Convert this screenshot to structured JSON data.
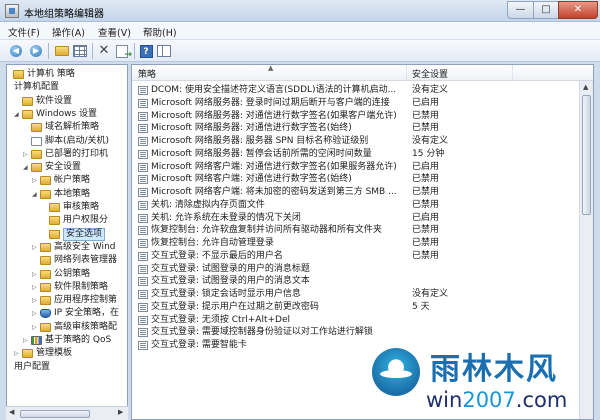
{
  "window": {
    "title": "本地组策略编辑器",
    "min": "—",
    "max": "□",
    "close": "✕"
  },
  "menu": [
    "文件(F)",
    "操作(A)",
    "查看(V)",
    "帮助(H)"
  ],
  "toolbar": {
    "icons": [
      "back-arrow-icon",
      "forward-arrow-icon",
      "up-folder-icon",
      "show-tree-icon",
      "delete-icon",
      "export-list-icon",
      "help-icon",
      "pane-view-icon"
    ],
    "back": "◀",
    "forward": "▶",
    "delete": "✕",
    "help": "?"
  },
  "tree": [
    {
      "label": "计算机 策略",
      "indent": 0,
      "icon": "computer",
      "expander": ""
    },
    {
      "label": "计算机配置",
      "indent": 0,
      "icon": "none",
      "expander": ""
    },
    {
      "label": "软件设置",
      "indent": 1,
      "icon": "folder",
      "expander": ""
    },
    {
      "label": "Windows 设置",
      "indent": 1,
      "icon": "folder",
      "expander": "◢"
    },
    {
      "label": "域名解析策略",
      "indent": 2,
      "icon": "folder",
      "expander": ""
    },
    {
      "label": "脚本(启动/关机)",
      "indent": 2,
      "icon": "doc",
      "expander": ""
    },
    {
      "label": "已部署的打印机",
      "indent": 2,
      "icon": "folder",
      "expander": "▷"
    },
    {
      "label": "安全设置",
      "indent": 2,
      "icon": "sec",
      "expander": "◢"
    },
    {
      "label": "帐户策略",
      "indent": 3,
      "icon": "folder",
      "expander": "▷"
    },
    {
      "label": "本地策略",
      "indent": 3,
      "icon": "folder",
      "expander": "◢"
    },
    {
      "label": "审核策略",
      "indent": 4,
      "icon": "folder",
      "expander": ""
    },
    {
      "label": "用户权限分",
      "indent": 4,
      "icon": "folder",
      "expander": ""
    },
    {
      "label": "安全选项",
      "indent": 4,
      "icon": "folder",
      "expander": "",
      "selected": true
    },
    {
      "label": "高级安全 Wind",
      "indent": 3,
      "icon": "folder",
      "expander": "▷"
    },
    {
      "label": "网络列表管理器",
      "indent": 3,
      "icon": "folder",
      "expander": ""
    },
    {
      "label": "公钥策略",
      "indent": 3,
      "icon": "folder",
      "expander": "▷"
    },
    {
      "label": "软件限制策略",
      "indent": 3,
      "icon": "folder",
      "expander": "▷"
    },
    {
      "label": "应用程序控制第",
      "indent": 3,
      "icon": "folder",
      "expander": "▷"
    },
    {
      "label": "IP 安全策略，在",
      "indent": 3,
      "icon": "shield",
      "expander": "▷"
    },
    {
      "label": "高级审核策略配",
      "indent": 3,
      "icon": "folder",
      "expander": "▷"
    },
    {
      "label": "基于策略的 QoS",
      "indent": 2,
      "icon": "chart",
      "expander": "▷"
    },
    {
      "label": "管理模板",
      "indent": 1,
      "icon": "folder",
      "expander": "▷"
    },
    {
      "label": "用户配置",
      "indent": 0,
      "icon": "none",
      "expander": ""
    }
  ],
  "list": {
    "columns": {
      "policy": "策略",
      "setting": "安全设置"
    },
    "rows": [
      {
        "policy": "DCOM: 使用安全描述符定义语言(SDDL)语法的计算机启动...",
        "setting": "没有定义"
      },
      {
        "policy": "Microsoft 网络服务器: 登录时间过期后断开与客户端的连接",
        "setting": "已启用"
      },
      {
        "policy": "Microsoft 网络服务器: 对通信进行数字签名(如果客户端允许)",
        "setting": "已禁用"
      },
      {
        "policy": "Microsoft 网络服务器: 对通信进行数字签名(始终)",
        "setting": "已禁用"
      },
      {
        "policy": "Microsoft 网络服务器: 服务器 SPN 目标名称验证级别",
        "setting": "没有定义"
      },
      {
        "policy": "Microsoft 网络服务器: 暂停会话前所需的空闲时间数量",
        "setting": "15 分钟"
      },
      {
        "policy": "Microsoft 网络客户端: 对通信进行数字签名(如果服务器允许)",
        "setting": "已启用"
      },
      {
        "policy": "Microsoft 网络客户端: 对通信进行数字签名(始终)",
        "setting": "已禁用"
      },
      {
        "policy": "Microsoft 网络客户端: 将未加密的密码发送到第三方 SMB ...",
        "setting": "已禁用"
      },
      {
        "policy": "关机: 清除虚拟内存页面文件",
        "setting": "已禁用"
      },
      {
        "policy": "关机: 允许系统在未登录的情况下关闭",
        "setting": "已启用"
      },
      {
        "policy": "恢复控制台: 允许软盘复制并访问所有驱动器和所有文件夹",
        "setting": "已禁用"
      },
      {
        "policy": "恢复控制台: 允许自动管理登录",
        "setting": "已禁用"
      },
      {
        "policy": "交互式登录: 不显示最后的用户名",
        "setting": "已禁用"
      },
      {
        "policy": "交互式登录: 试图登录的用户的消息标题",
        "setting": ""
      },
      {
        "policy": "交互式登录: 试图登录的用户的消息文本",
        "setting": ""
      },
      {
        "policy": "交互式登录: 锁定会话时显示用户信息",
        "setting": "没有定义"
      },
      {
        "policy": "交互式登录: 提示用户在过期之前更改密码",
        "setting": "5 天"
      },
      {
        "policy": "交互式登录: 无须按 Ctrl+Alt+Del",
        "setting": ""
      },
      {
        "policy": "交互式登录: 需要域控制器身份验证以对工作站进行解锁",
        "setting": ""
      },
      {
        "policy": "交互式登录: 需要智能卡",
        "setting": ""
      }
    ]
  },
  "watermark": {
    "title": "雨林木风",
    "url_prefix": "win",
    "url_accent": "2007",
    "url_suffix": ".com"
  }
}
